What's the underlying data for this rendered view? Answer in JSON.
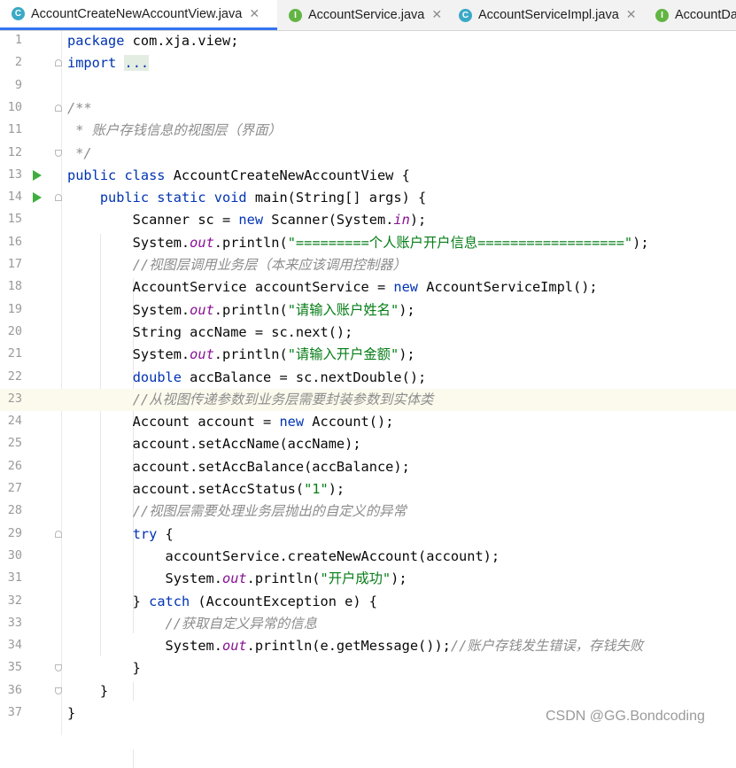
{
  "tabs": [
    {
      "name": "AccountCreateNewAccountView.java",
      "icon": "java-class-icon",
      "letter": "C",
      "color": "#3aa9c6",
      "active": true,
      "close": "✕"
    },
    {
      "name": "AccountService.java",
      "icon": "java-interface-icon",
      "letter": "I",
      "color": "#62b543",
      "active": false,
      "close": "✕"
    },
    {
      "name": "AccountServiceImpl.java",
      "icon": "java-class-icon",
      "letter": "C",
      "color": "#3aa9c6",
      "active": false,
      "close": "✕"
    },
    {
      "name": "AccountDa",
      "icon": "java-interface-icon",
      "letter": "I",
      "color": "#62b543",
      "active": false,
      "close": ""
    }
  ],
  "editor": {
    "current_line": "23",
    "lines": [
      {
        "n": "1",
        "html": "<span class=\"kw\">package</span> com.xja.view;"
      },
      {
        "n": "2",
        "html": "<span class=\"kw\">import</span> <span class=\"fold\">...</span>",
        "fold": "close"
      },
      {
        "n": "9",
        "html": ""
      },
      {
        "n": "10",
        "html": "<span class=\"cm\">/**</span>",
        "fold": "close"
      },
      {
        "n": "11",
        "html": "<span class=\"cm\"> * 账户存钱信息的视图层（界面）</span>"
      },
      {
        "n": "12",
        "html": "<span class=\"cm\"> */</span>",
        "fold": "open"
      },
      {
        "n": "13",
        "html": "<span class=\"kw\">public class</span> AccountCreateNewAccountView {",
        "run": true
      },
      {
        "n": "14",
        "html": "    <span class=\"kw\">public static void</span> main(String[] args) {",
        "run": true,
        "fold": "close"
      },
      {
        "n": "15",
        "html": "        Scanner sc = <span class=\"kw\">new</span> Scanner(System.<span class=\"fld\">in</span>);"
      },
      {
        "n": "16",
        "html": "        System.<span class=\"fld\">out</span>.println(<span class=\"str\">\"=========个人账户开户信息==================\"</span>);"
      },
      {
        "n": "17",
        "html": "        <span class=\"cm\">//视图层调用业务层（本来应该调用控制器）</span>"
      },
      {
        "n": "18",
        "html": "        AccountService accountService = <span class=\"kw\">new</span> AccountServiceImpl();"
      },
      {
        "n": "19",
        "html": "        System.<span class=\"fld\">out</span>.println(<span class=\"str\">\"请输入账户姓名\"</span>);"
      },
      {
        "n": "20",
        "html": "        String accName = sc.next();"
      },
      {
        "n": "21",
        "html": "        System.<span class=\"fld\">out</span>.println(<span class=\"str\">\"请输入开户金额\"</span>);"
      },
      {
        "n": "22",
        "html": "        <span class=\"kw\">double</span> accBalance = sc.nextDouble();"
      },
      {
        "n": "23",
        "html": "        <span class=\"cm\">//从视图传递参数到业务层需要封装参数到实体类</span>"
      },
      {
        "n": "24",
        "html": "        Account account = <span class=\"kw\">new</span> Account();"
      },
      {
        "n": "25",
        "html": "        account.setAccName(accName);"
      },
      {
        "n": "26",
        "html": "        account.setAccBalance(accBalance);"
      },
      {
        "n": "27",
        "html": "        account.setAccStatus(<span class=\"str\">\"1\"</span>);"
      },
      {
        "n": "28",
        "html": "        <span class=\"cm\">//视图层需要处理业务层抛出的自定义的异常</span>"
      },
      {
        "n": "29",
        "html": "        <span class=\"kw\">try</span> {",
        "fold": "close"
      },
      {
        "n": "30",
        "html": "            accountService.createNewAccount(account);"
      },
      {
        "n": "31",
        "html": "            System.<span class=\"fld\">out</span>.println(<span class=\"str\">\"开户成功\"</span>);"
      },
      {
        "n": "32",
        "html": "        } <span class=\"kw\">catch</span> (AccountException e) {"
      },
      {
        "n": "33",
        "html": "            <span class=\"cm\">//获取自定义异常的信息</span>"
      },
      {
        "n": "34",
        "html": "            System.<span class=\"fld\">out</span>.println(e.getMessage());<span class=\"cm\">//账户存钱发生错误，存钱失败</span>"
      },
      {
        "n": "35",
        "html": "        }",
        "fold": "open"
      },
      {
        "n": "36",
        "html": "    }",
        "fold": "open"
      },
      {
        "n": "37",
        "html": "}"
      }
    ]
  },
  "watermark": "CSDN @GG.Bondcoding",
  "colors": {
    "keyword": "#0033b3",
    "string": "#067d17",
    "comment": "#8c8c8c",
    "static_field": "#871094",
    "current_line_bg": "#fcfaed",
    "active_tab_underline": "#3574f0"
  }
}
